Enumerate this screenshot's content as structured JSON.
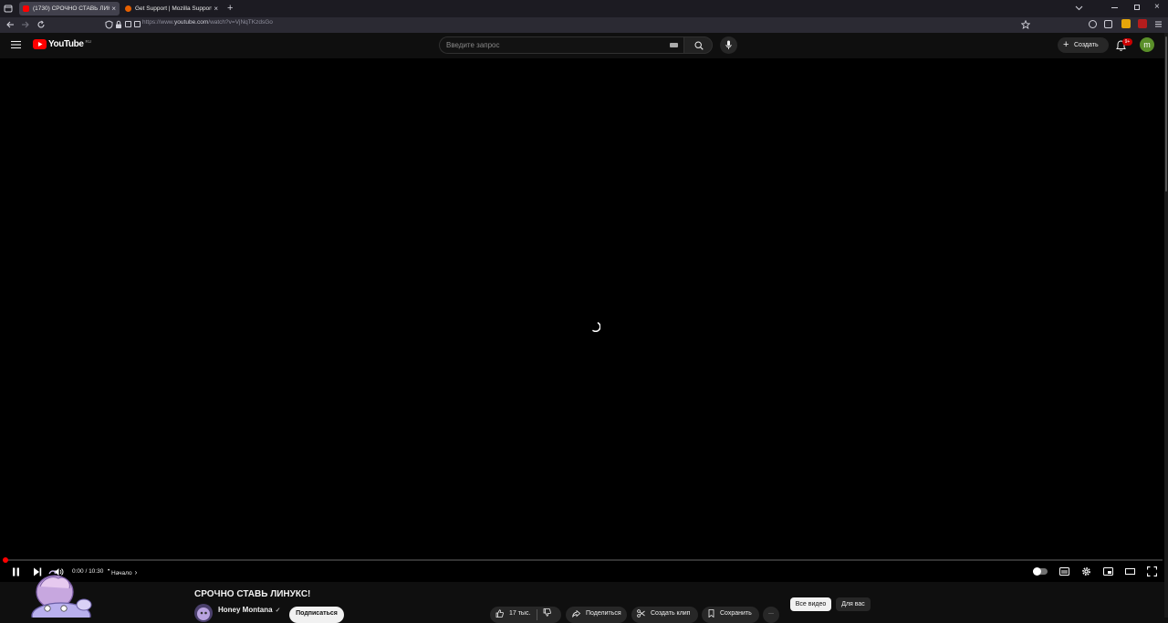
{
  "browser": {
    "tabs": [
      {
        "title": "(1730) СРОЧНО СТАВЬ ЛИНУК",
        "active": true,
        "favicon_color": "#ff0000"
      },
      {
        "title": "Get Support | Mozilla Support",
        "active": false,
        "favicon_color": "#e66000"
      }
    ],
    "url_prefix": "https://www.",
    "url_domain": "youtube.com",
    "url_path": "/watch?v=VjNqTKzdsGo"
  },
  "youtube": {
    "logo_text": "YouTube",
    "region": "RU",
    "search_placeholder": "Введите запрос",
    "create_label": "Создать",
    "notifications_badge": "9+",
    "avatar_letter": "m"
  },
  "player": {
    "time": "0:00 / 10:30",
    "chapter": "Начало",
    "progress": 0
  },
  "video": {
    "title": "СРОЧНО СТАВЬ ЛИНУКС!",
    "channel": "Honey Montana",
    "subscribe_label": "Подписаться",
    "likes": "17 тыс.",
    "share_label": "Поделиться",
    "clip_label": "Создать клип",
    "save_label": "Сохранить",
    "more_label": "···"
  },
  "chips": {
    "all": "Все видео",
    "for_you": "Для вас"
  },
  "colors": {
    "accent": "#ff0000",
    "background": "#0f0f0f",
    "avatar": "#5a8f29"
  }
}
